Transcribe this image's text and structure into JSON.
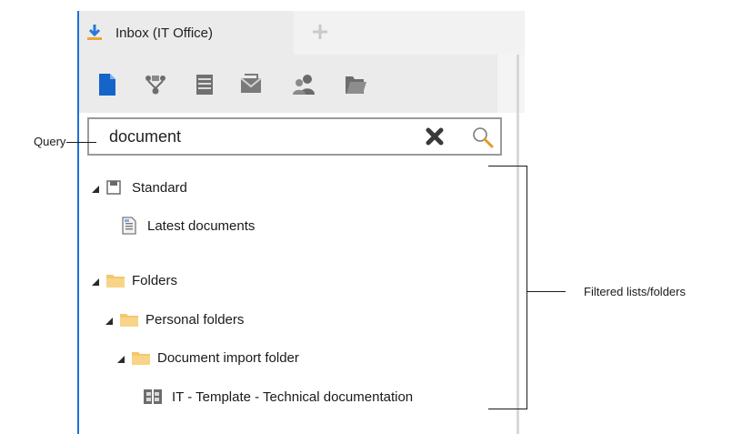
{
  "tabs": {
    "active_label": "Inbox (IT Office)",
    "add_icon": "plus-icon"
  },
  "toolbar": {
    "icons": [
      "document-icon",
      "workflow-icon",
      "list-icon",
      "mail-icon",
      "users-icon",
      "folder-open-icon"
    ]
  },
  "search": {
    "value": "document",
    "clear_icon": "clear-icon",
    "search_icon": "search-icon"
  },
  "tree": {
    "standard": {
      "label": "Standard",
      "children": [
        {
          "label": "Latest documents"
        }
      ]
    },
    "folders": {
      "label": "Folders",
      "personal": {
        "label": "Personal folders",
        "import_folder": {
          "label": "Document import folder",
          "template": {
            "label": "IT - Template - Technical documentation"
          }
        }
      }
    }
  },
  "annotations": {
    "query": "Query",
    "filtered": "Filtered lists/folders"
  },
  "colors": {
    "accent": "#1f6fd6",
    "folder": "#f5c76a",
    "border": "#9a9a9a"
  }
}
